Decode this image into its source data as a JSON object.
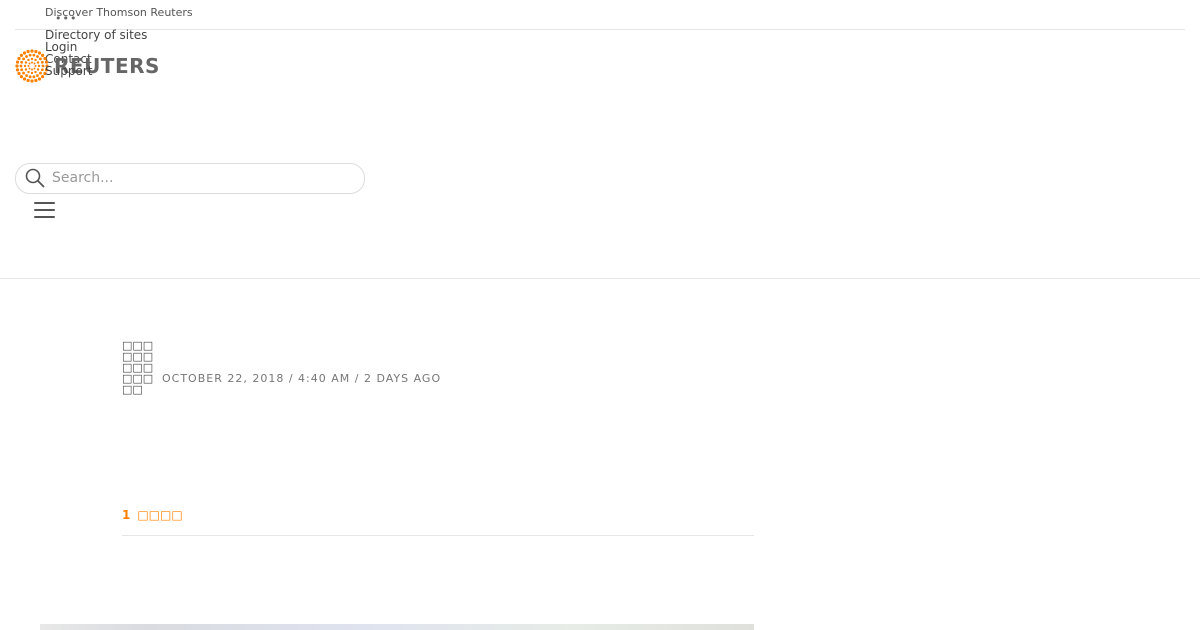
{
  "topbar": {
    "discover_label": "Discover Thomson Reuters",
    "more_icon": "ellipsis-icon",
    "links": {
      "directory": "Directory of sites",
      "login": "Login",
      "contact": "Contact",
      "support": "Support"
    }
  },
  "brand": {
    "name": "REUTERS",
    "logo_icon": "reuters-dot-ring-logo",
    "accent_color": "#ff8000"
  },
  "search": {
    "placeholder": "Search...",
    "value": "",
    "icon": "search-icon"
  },
  "nav": {
    "menu_icon": "hamburger-menu-icon"
  },
  "article": {
    "byline": "□□□□□□□□□□□□□□",
    "dateline": "OCTOBER 22, 2018 / 4:40 AM / 2 DAYS AGO",
    "min_read_number": "1",
    "min_read_label": "□□□□"
  }
}
